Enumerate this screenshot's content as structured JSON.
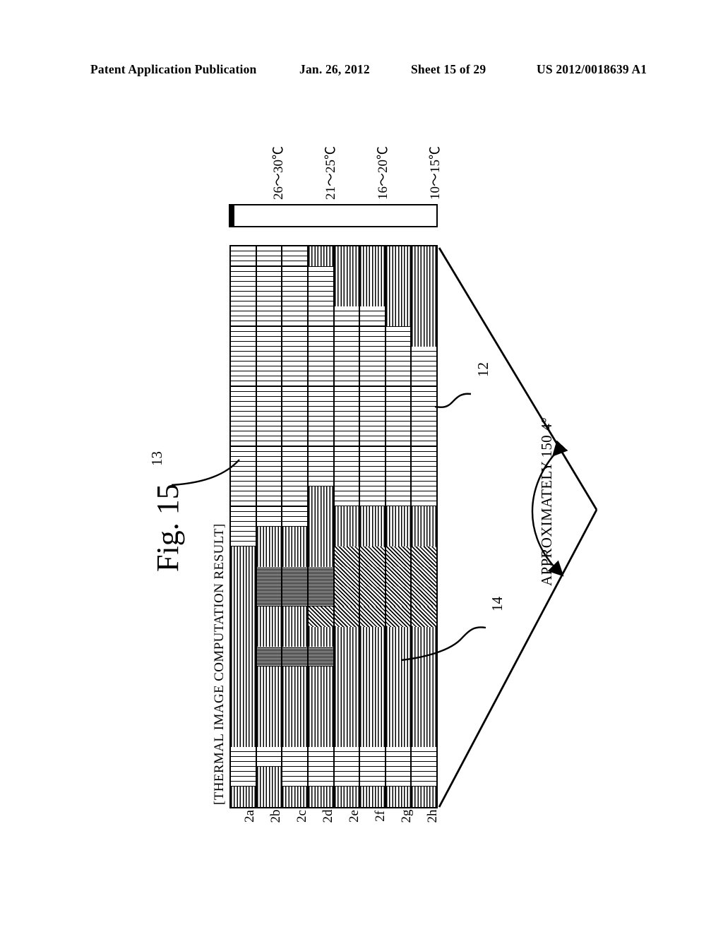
{
  "header": {
    "publication": "Patent Application Publication",
    "date": "Jan. 26, 2012",
    "sheet": "Sheet 15 of 29",
    "number": "US 2012/0018639 A1"
  },
  "figure": {
    "label": "Fig. 15",
    "caption": "[THERMAL IMAGE COMPUTATION RESULT]"
  },
  "legend": {
    "bands": [
      {
        "label": "26〜30℃",
        "pattern": "dense-dark",
        "swatch_class": "p-hot"
      },
      {
        "label": "21〜25℃",
        "pattern": "diagonal-hatch",
        "swatch_class": "p-warm"
      },
      {
        "label": "16〜20℃",
        "pattern": "vertical-lines",
        "swatch_class": "p-mid"
      },
      {
        "label": "10〜15℃",
        "pattern": "blank-white",
        "swatch_class": "p-cool"
      }
    ]
  },
  "callouts": [
    {
      "id": "12",
      "label": "12",
      "target": "warm-band-region"
    },
    {
      "id": "13",
      "label": "13",
      "target": "hot-spot-region"
    },
    {
      "id": "14",
      "label": "14",
      "target": "cool-region"
    }
  ],
  "angle": {
    "label": "APPROXIMATELY 150.4°",
    "value": 150.4
  },
  "axis": {
    "labels": [
      "2a",
      "2b",
      "2c",
      "2d",
      "2e",
      "2f",
      "2g",
      "2h"
    ]
  },
  "chart_data": {
    "type": "heatmap",
    "title": "[THERMAL IMAGE COMPUTATION RESULT]",
    "xlabel": "",
    "ylabel": "",
    "orientation": "rotated-90",
    "columns": [
      "2a",
      "2b",
      "2c",
      "2d",
      "2e",
      "2f",
      "2g",
      "2h"
    ],
    "rows": 28,
    "legend_position": "above-map",
    "grid": true,
    "category_levels": [
      {
        "name": "26〜30℃",
        "code": "hot",
        "class": "c-hot"
      },
      {
        "name": "21〜25℃",
        "code": "warm",
        "class": "c-warm"
      },
      {
        "name": "16〜20℃",
        "code": "mid",
        "class": "c-mid"
      },
      {
        "name": "10〜15℃",
        "code": "cool",
        "class": "c-cool"
      }
    ],
    "matrix": [
      [
        "cool",
        "cool",
        "cool",
        "cool",
        "cool",
        "cool",
        "cool",
        "cool",
        "cool",
        "cool",
        "cool",
        "cool",
        "cool",
        "cool",
        "cool",
        "mid",
        "mid",
        "mid",
        "mid",
        "mid",
        "mid",
        "mid",
        "mid",
        "mid",
        "mid",
        "cool",
        "cool",
        "mid"
      ],
      [
        "cool",
        "cool",
        "cool",
        "cool",
        "cool",
        "cool",
        "cool",
        "cool",
        "cool",
        "cool",
        "cool",
        "cool",
        "cool",
        "cool",
        "mid",
        "mid",
        "hot",
        "hot",
        "mid",
        "mid",
        "hot",
        "mid",
        "mid",
        "mid",
        "mid",
        "cool",
        "mid",
        "mid"
      ],
      [
        "cool",
        "cool",
        "cool",
        "cool",
        "cool",
        "cool",
        "cool",
        "cool",
        "cool",
        "cool",
        "cool",
        "cool",
        "cool",
        "cool",
        "mid",
        "mid",
        "hot",
        "hot",
        "mid",
        "mid",
        "hot",
        "mid",
        "mid",
        "mid",
        "mid",
        "cool",
        "cool",
        "mid"
      ],
      [
        "mid",
        "cool",
        "cool",
        "cool",
        "cool",
        "cool",
        "cool",
        "cool",
        "cool",
        "cool",
        "cool",
        "cool",
        "mid",
        "mid",
        "mid",
        "mid",
        "hot",
        "hot",
        "warm",
        "mid",
        "hot",
        "mid",
        "mid",
        "mid",
        "mid",
        "cool",
        "cool",
        "mid"
      ],
      [
        "mid",
        "mid",
        "mid",
        "cool",
        "cool",
        "cool",
        "cool",
        "cool",
        "cool",
        "cool",
        "cool",
        "cool",
        "cool",
        "mid",
        "mid",
        "warm",
        "warm",
        "warm",
        "warm",
        "mid",
        "mid",
        "mid",
        "mid",
        "mid",
        "mid",
        "cool",
        "cool",
        "mid"
      ],
      [
        "mid",
        "mid",
        "mid",
        "cool",
        "cool",
        "cool",
        "cool",
        "cool",
        "cool",
        "cool",
        "cool",
        "cool",
        "cool",
        "mid",
        "mid",
        "warm",
        "warm",
        "warm",
        "warm",
        "mid",
        "mid",
        "mid",
        "mid",
        "mid",
        "mid",
        "cool",
        "cool",
        "mid"
      ],
      [
        "mid",
        "mid",
        "mid",
        "mid",
        "cool",
        "cool",
        "cool",
        "cool",
        "cool",
        "cool",
        "cool",
        "cool",
        "cool",
        "mid",
        "mid",
        "warm",
        "warm",
        "warm",
        "warm",
        "mid",
        "mid",
        "mid",
        "mid",
        "mid",
        "mid",
        "cool",
        "cool",
        "mid"
      ],
      [
        "mid",
        "mid",
        "mid",
        "mid",
        "mid",
        "cool",
        "cool",
        "cool",
        "cool",
        "cool",
        "cool",
        "cool",
        "cool",
        "mid",
        "mid",
        "warm",
        "warm",
        "warm",
        "warm",
        "mid",
        "mid",
        "mid",
        "mid",
        "mid",
        "mid",
        "cool",
        "cool",
        "mid"
      ]
    ]
  }
}
